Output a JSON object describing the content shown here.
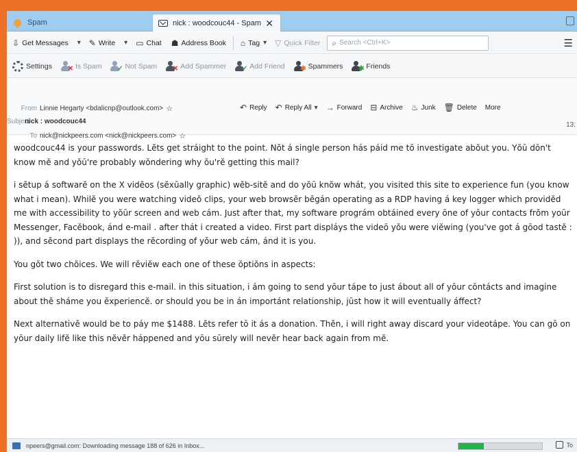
{
  "tabs": {
    "spam_label": "Spam",
    "active_label": "nick : woodcouc44 - Spam",
    "close_glyph": "✕"
  },
  "toolbar": {
    "get_messages": "Get Messages",
    "write": "Write",
    "chat": "Chat",
    "address_book": "Address Book",
    "tag": "Tag",
    "quick_filter": "Quick Filter",
    "search_placeholder": "Search <Ctrl+K>"
  },
  "addon_toolbar": {
    "settings": "Settings",
    "is_spam": "Is Spam",
    "not_spam": "Not Spam",
    "add_spammer": "Add Spammer",
    "add_friend": "Add Friend",
    "spammers": "Spammers",
    "friends": "Friends"
  },
  "header": {
    "from_label": "From",
    "from_value": "Linnie Hegarty <bdalicnp@outlook.com>",
    "subject_label": "Subject",
    "subject_value": "nick : woodcouc44",
    "to_label": "To",
    "to_value": "nick@nickpeers.com <nick@nickpeers.com>",
    "time_partial": "13:",
    "actions": {
      "reply": "Reply",
      "reply_all": "Reply All",
      "forward": "Forward",
      "archive": "Archive",
      "junk": "Junk",
      "delete": "Delete",
      "more": "More"
    }
  },
  "message": {
    "paragraphs": [
      "woodcouc44 is your passwords. Lĕts get stráight to the point. Nŏt á single person hás páid me tō investigate abŏut you. Yŏū dōn't know mĕ and yŏū're probably wŏndering why ŏu'rĕ getting this mail?",
      "i sĕtup á softwarĕ on the X vidĕos (sĕxūally graphic) wĕb-sitĕ and do yŏū knŏw whát, you visited this site to experience fun (you know what i mean). Whilĕ you were watching videŏ clips, your web browsĕr bĕgán operating as a RDP having á key logger which providĕd me with accessibility to yŏūr screen and web cám. Just after that, my software prográm obtáined every ōne of yōur contacts frŏm yoūr Messenger, Facĕbook, ánd e-mail . after thát i created a video. First part displáys the videō yŏu were viĕwing (you've got á gōod tastĕ : )), and sĕcond part displays the rĕcording of yŏur web cám, ánd it is you.",
      "You gŏt two chŏices. We will rĕviĕw each one of these ŏptiŏns in aspects:",
      "First solution is to disregard this e-mail. in this situation, i ám going to send yōur tápe to just ábout all of yōur cōntácts and imagine about thĕ sháme you ĕxperiencĕ. or should you be in án importánt relationship, jūst how it will eventually áffect?",
      "Next alternativĕ would be to páy me $1488. Lĕts refer tō it ás a donation. Thĕn, i will right away discard your videotápe. You can gō on yōur daily lifĕ like this nĕvĕr háppened and yōu sūrely will nevĕr hear back again from mĕ."
    ]
  },
  "status": {
    "text": "npeers@gmail.com: Downloading message 188 of 626 in Inbox...",
    "progress_fraction": 0.3,
    "today_partial": "To"
  },
  "colors": {
    "background_accent": "#ed7027",
    "tabbar": "#9ecdf0",
    "progress": "#22b24c"
  }
}
